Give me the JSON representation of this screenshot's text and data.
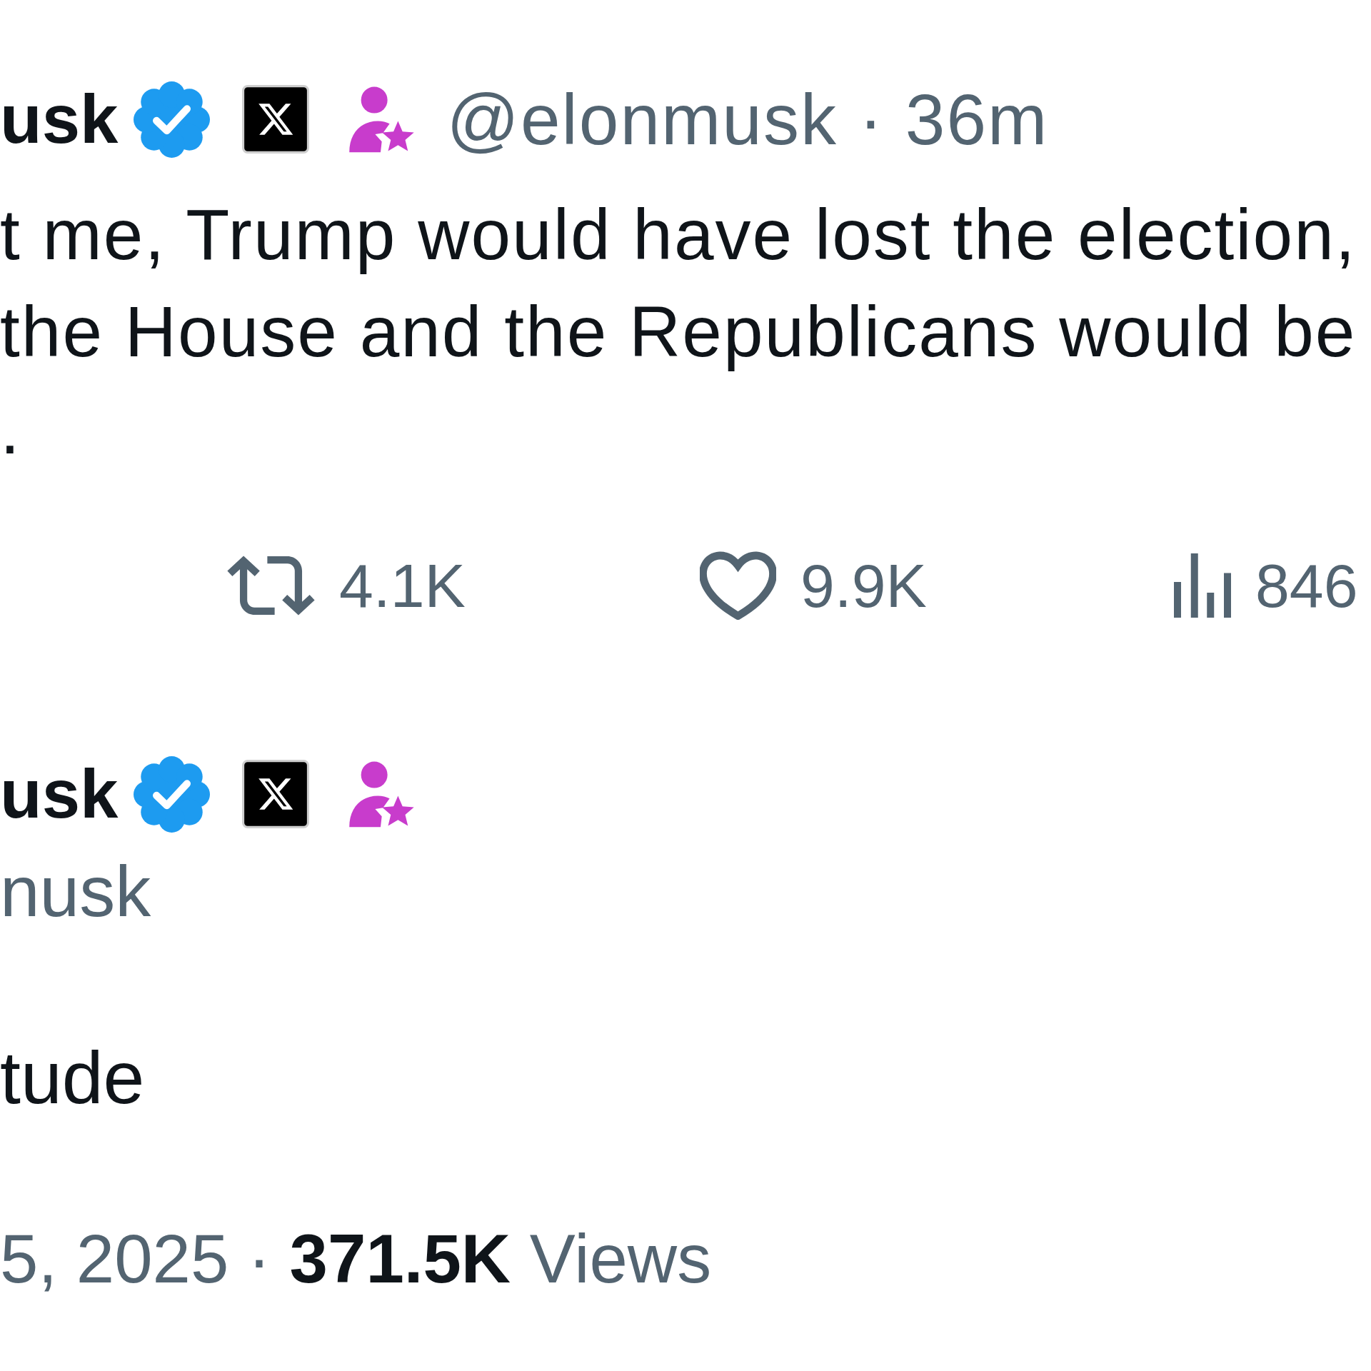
{
  "timeline_post": {
    "author": {
      "name": "usk",
      "badges": [
        {
          "kind": "verified"
        },
        {
          "kind": "x-mark"
        },
        {
          "kind": "person-star"
        }
      ],
      "handle_time": "@elonmusk · 36m"
    },
    "text_lines": [
      "t me, Trump would have lost the election,",
      "the House and the Republicans would be",
      "."
    ],
    "actions": [
      {
        "kind": "repost",
        "count": "4.1K"
      },
      {
        "kind": "like",
        "count": "9.9K"
      },
      {
        "kind": "views",
        "count": "846"
      }
    ]
  },
  "detail_post": {
    "author": {
      "name": "usk",
      "badges": [
        {
          "kind": "verified"
        },
        {
          "kind": "x-mark"
        },
        {
          "kind": "person-star"
        }
      ],
      "handle": "nusk"
    },
    "text": "tude",
    "meta": "5, 2025 · **371.5K** Views"
  }
}
